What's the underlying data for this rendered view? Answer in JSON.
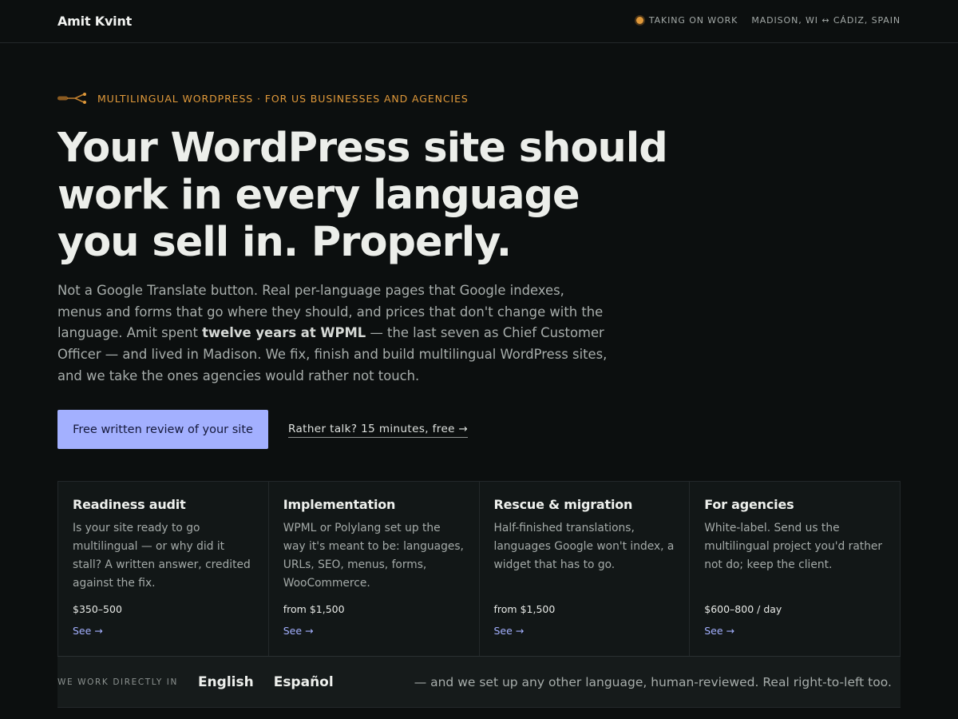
{
  "header": {
    "brand": "Amit Kvint",
    "status": "TAKING ON WORK",
    "location": "MADISON, WI ↔ CÁDIZ, SPAIN",
    "status_color": "#e0993a"
  },
  "hero": {
    "eyebrow": "MULTILINGUAL WORDPRESS · FOR US BUSINESSES AND AGENCIES",
    "headline_lines": [
      "Your WordPress site should",
      "work in every language",
      "you sell in. Properly."
    ],
    "lede": {
      "before": "Not a Google Translate button. Real per-language pages that Google indexes, menus and forms that go where they should, and prices that don't change with the language. Amit spent ",
      "strong": "twelve years at WPML",
      "after": " — the last seven as Chief Customer Officer — and lived in Madison. We fix, finish and build multilingual WordPress sites, and we take the ones agencies would rather not touch."
    },
    "primary_cta": "Free written review of your site",
    "secondary_cta": "Rather talk? 15 minutes, free →"
  },
  "services": [
    {
      "title": "Readiness audit",
      "description": "Is your site ready to go multilingual — or why did it stall? A written answer, credited against the fix.",
      "price": "$350–500",
      "link": "See →"
    },
    {
      "title": "Implementation",
      "description": "WPML or Polylang set up the way it's meant to be: languages, URLs, SEO, menus, forms, WooCommerce.",
      "price": "from $1,500",
      "link": "See →"
    },
    {
      "title": "Rescue & migration",
      "description": "Half-finished translations, languages Google won't index, a widget that has to go.",
      "price": "from $1,500",
      "link": "See →"
    },
    {
      "title": "For agencies",
      "description": "White-label. Send us the multilingual project you'd rather not do; keep the client.",
      "price": "$600–800 / day",
      "link": "See →"
    }
  ],
  "languages": {
    "label": "WE WORK DIRECTLY IN",
    "items": [
      "English",
      "Español"
    ],
    "note": "— and we set up any other language, human-reviewed. Real right-to-left too."
  },
  "colors": {
    "accent": "#a3b0ff",
    "highlight": "#e0993a",
    "background": "#0c0f0f"
  }
}
